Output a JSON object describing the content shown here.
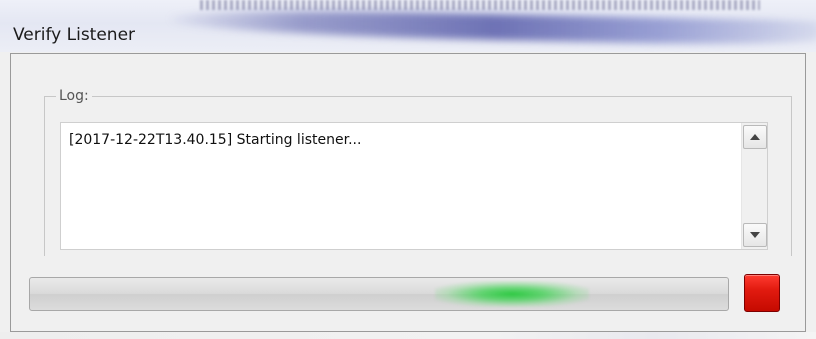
{
  "window": {
    "title": "Verify Listener"
  },
  "log_group": {
    "label": "Log:",
    "lines": [
      "[2017-12-22T13.40.15] Starting listener..."
    ]
  },
  "scrollbar": {
    "up_icon": "triangle-up-icon",
    "down_icon": "triangle-down-icon"
  },
  "progress": {
    "state": "indeterminate",
    "indicator_color": "#2ec84a",
    "indicator_start_fraction": 0.58,
    "indicator_end_fraction": 0.8
  },
  "stop_button": {
    "icon": "stop-icon",
    "color": "#e21b10"
  }
}
